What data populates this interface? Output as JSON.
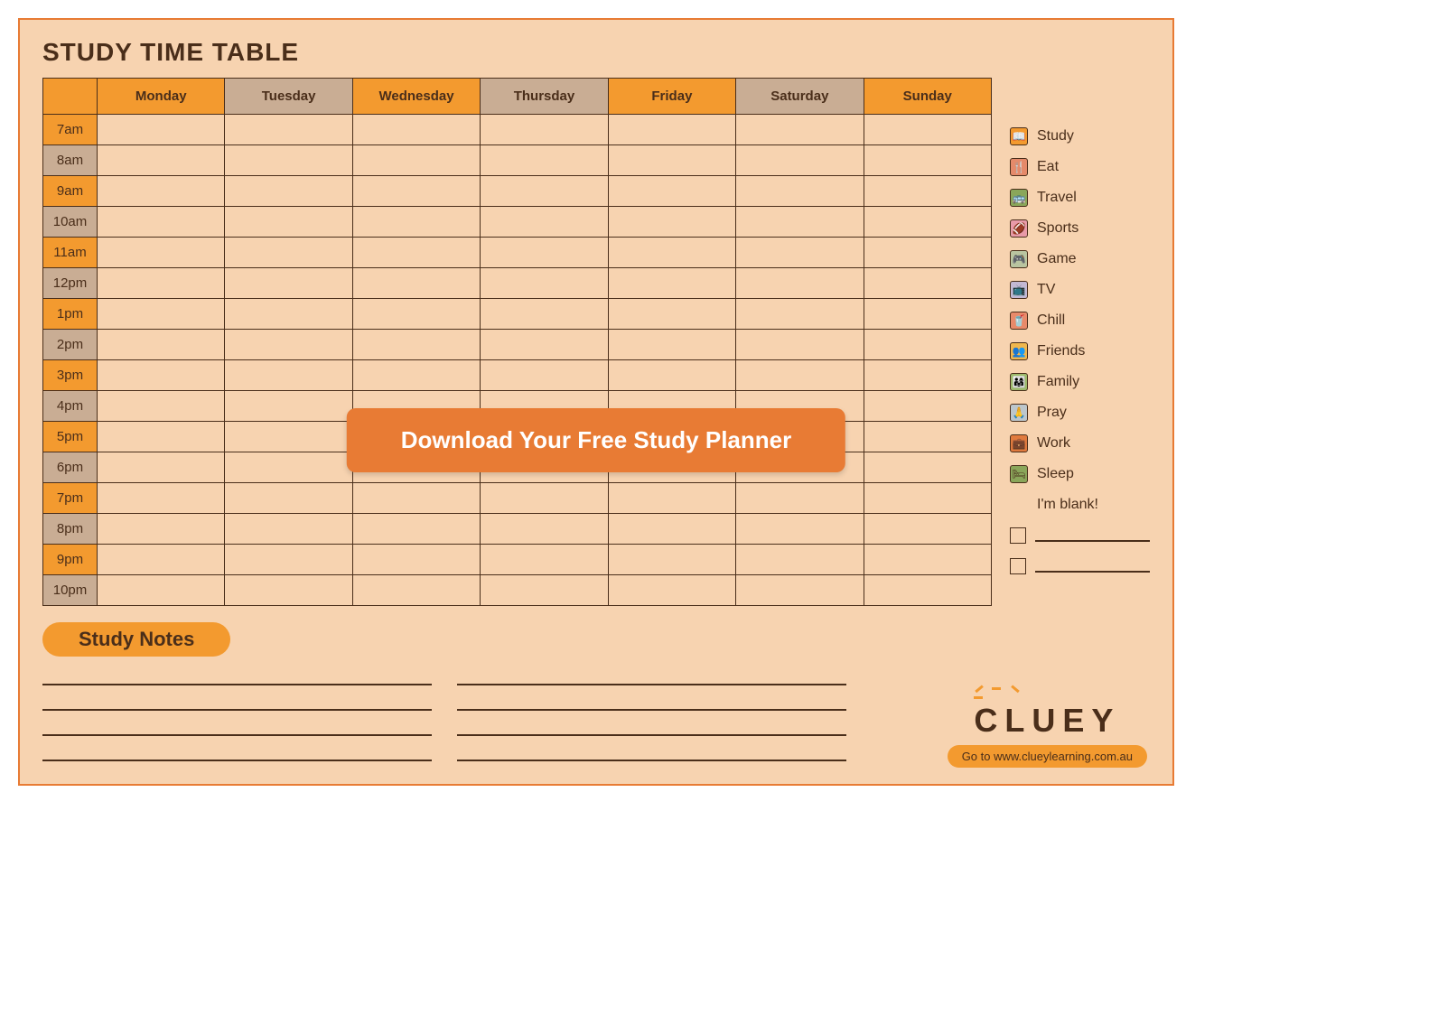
{
  "title": "STUDY TIME TABLE",
  "days": [
    "Monday",
    "Tuesday",
    "Wednesday",
    "Thursday",
    "Friday",
    "Saturday",
    "Sunday"
  ],
  "day_colors": [
    "orange",
    "tan",
    "orange",
    "tan",
    "orange",
    "tan",
    "orange"
  ],
  "times": [
    "7am",
    "8am",
    "9am",
    "10am",
    "11am",
    "12pm",
    "1pm",
    "2pm",
    "3pm",
    "4pm",
    "5pm",
    "6pm",
    "7pm",
    "8pm",
    "9pm",
    "10pm"
  ],
  "time_colors": [
    "orange",
    "tan",
    "orange",
    "tan",
    "orange",
    "tan",
    "orange",
    "tan",
    "orange",
    "tan",
    "orange",
    "tan",
    "orange",
    "tan",
    "orange",
    "tan"
  ],
  "thick_rows": [
    6,
    11
  ],
  "legend": [
    {
      "label": "Study",
      "bg": "#f39a2f",
      "glyph": "📖"
    },
    {
      "label": "Eat",
      "bg": "#e58a6a",
      "glyph": "🍴"
    },
    {
      "label": "Travel",
      "bg": "#8aa65a",
      "glyph": "🚌"
    },
    {
      "label": "Sports",
      "bg": "#e89aa8",
      "glyph": "🏈"
    },
    {
      "label": "Game",
      "bg": "#b9c4a0",
      "glyph": "🎮"
    },
    {
      "label": "TV",
      "bg": "#c3b8d4",
      "glyph": "📺"
    },
    {
      "label": "Chill",
      "bg": "#e88a6a",
      "glyph": "🥤"
    },
    {
      "label": "Friends",
      "bg": "#f0b74e",
      "glyph": "👥"
    },
    {
      "label": "Family",
      "bg": "#9dbb6c",
      "glyph": "👨‍👩‍👧"
    },
    {
      "label": "Pray",
      "bg": "#bcc6cc",
      "glyph": "🙏"
    },
    {
      "label": "Work",
      "bg": "#e07a3e",
      "glyph": "💼"
    },
    {
      "label": "Sleep",
      "bg": "#8aa65a",
      "glyph": "🛏"
    }
  ],
  "blank_label": "I'm blank!",
  "notes_title": "Study Notes",
  "notes_line_count": 4,
  "cta_label": "Download Your Free Study Planner",
  "brand_name": "CLUEY",
  "brand_url_label": "Go to www.clueylearning.com.au"
}
